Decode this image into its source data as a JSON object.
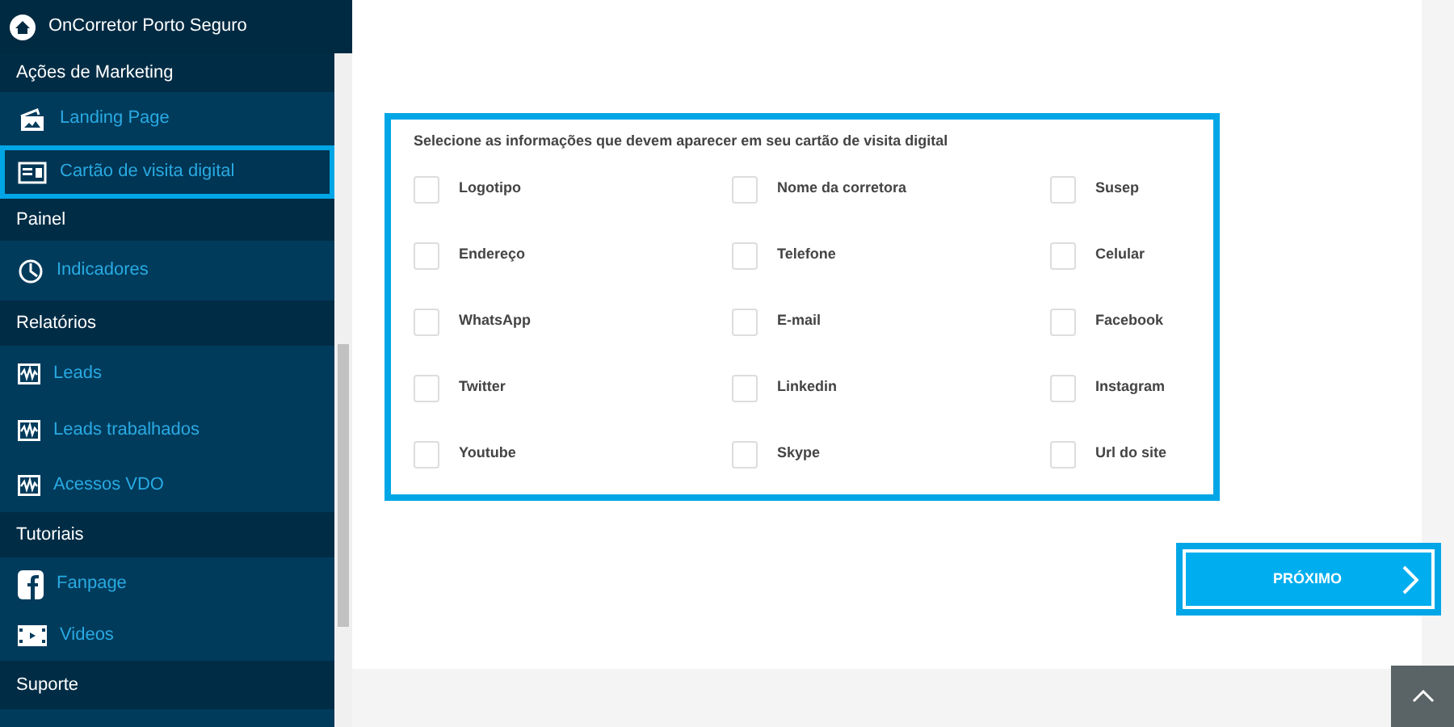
{
  "header": {
    "title": "OnCorretor Porto Seguro"
  },
  "sidebar": {
    "groups": [
      {
        "title": "Ações de Marketing",
        "items": [
          {
            "label": "Landing Page",
            "kind": "landing",
            "selected": false
          },
          {
            "label": "Cartão de visita digital",
            "kind": "card",
            "selected": true
          }
        ]
      },
      {
        "title": "Painel",
        "items": [
          {
            "label": "Indicadores",
            "kind": "clock",
            "selected": false
          }
        ]
      },
      {
        "title": "Relatórios",
        "items": [
          {
            "label": "Leads",
            "kind": "chart",
            "selected": false
          },
          {
            "label": "Leads trabalhados",
            "kind": "chart",
            "selected": false
          },
          {
            "label": "Acessos VDO",
            "kind": "chart",
            "selected": false
          }
        ]
      },
      {
        "title": "Tutoriais",
        "items": [
          {
            "label": "Fanpage",
            "kind": "facebook",
            "selected": false
          },
          {
            "label": "Videos",
            "kind": "video",
            "selected": false
          }
        ]
      },
      {
        "title": "Suporte"
      }
    ]
  },
  "form": {
    "prompt": "Selecione as informações que devem aparecer em seu cartão de visita digital",
    "options": [
      {
        "label": "Logotipo",
        "checked": false
      },
      {
        "label": "Nome da corretora",
        "checked": false
      },
      {
        "label": "Susep",
        "checked": false
      },
      {
        "label": "Endereço",
        "checked": false
      },
      {
        "label": "Telefone",
        "checked": false
      },
      {
        "label": "Celular",
        "checked": false
      },
      {
        "label": "WhatsApp",
        "checked": false
      },
      {
        "label": "E-mail",
        "checked": false
      },
      {
        "label": "Facebook",
        "checked": false
      },
      {
        "label": "Twitter",
        "checked": false
      },
      {
        "label": "Linkedin",
        "checked": false
      },
      {
        "label": "Instagram",
        "checked": false
      },
      {
        "label": "Youtube",
        "checked": false
      },
      {
        "label": "Skype",
        "checked": false
      },
      {
        "label": "Url do site",
        "checked": false
      }
    ]
  },
  "next_button": {
    "label": "PRÓXIMO"
  }
}
